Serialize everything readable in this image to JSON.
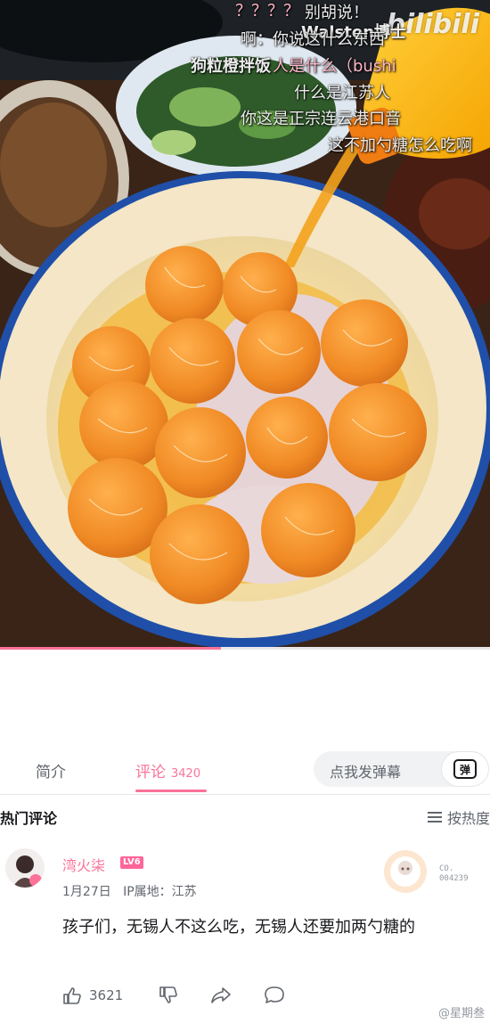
{
  "video": {
    "watermark": "bilibili",
    "progress_fraction": 0.45,
    "danmaku": [
      {
        "text": "别胡说！",
        "cls": ""
      },
      {
        "text": "Walston博士",
        "cls": "bold"
      },
      {
        "text": "？？？？",
        "cls": "pink"
      },
      {
        "text": "啊：你说这什么东西",
        "cls": ""
      },
      {
        "text": "狗粒橙拌饭",
        "cls": "bold"
      },
      {
        "text": "人是什么（bushi",
        "cls": "pink"
      },
      {
        "text": "什么是江苏人",
        "cls": ""
      },
      {
        "text": "你这是正宗连云港口音",
        "cls": ""
      },
      {
        "text": "这不加勺糖怎么吃啊",
        "cls": ""
      }
    ]
  },
  "tabs": {
    "intro": "简介",
    "comments": "评论",
    "comments_count": "3420"
  },
  "danmaku_input": {
    "placeholder": "点我发弹幕",
    "button_label": "弹"
  },
  "comments_section": {
    "title": "热门评论",
    "sort_label": "按热度"
  },
  "comment": {
    "user": "湾火柒",
    "level": "LV6",
    "date": "1月27日",
    "location": "IP属地：江苏",
    "badge_number": "004239",
    "badge_prefix": "CO.",
    "text": "孩子们，无锡人不这么吃，无锡人还要加两勺糖的",
    "likes": "3621"
  },
  "source_mark": "@星期叁",
  "colors": {
    "accent": "#fb7299",
    "level_badge": "#ff6699",
    "bowl_rim": "#1f4fa8",
    "orange": "#f08a24"
  }
}
